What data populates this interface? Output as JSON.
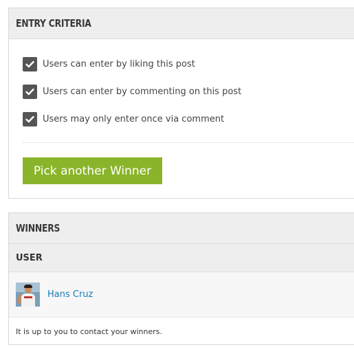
{
  "entry_panel": {
    "title": "ENTRY CRITERIA",
    "criteria": [
      {
        "label": "Users can enter by liking this post",
        "checked": true
      },
      {
        "label": "Users can enter by commenting on this post",
        "checked": true
      },
      {
        "label": "Users may only enter once via comment",
        "checked": true
      }
    ],
    "pick_button_label": "Pick another Winner"
  },
  "winners_panel": {
    "title": "WINNERS",
    "column_header": "USER",
    "winners": [
      {
        "name": "Hans Cruz"
      }
    ],
    "note": "It is up to you to contact your winners."
  },
  "colors": {
    "accent_button": "#8ab52a",
    "link": "#1a7ab5",
    "checkbox": "#555555"
  }
}
